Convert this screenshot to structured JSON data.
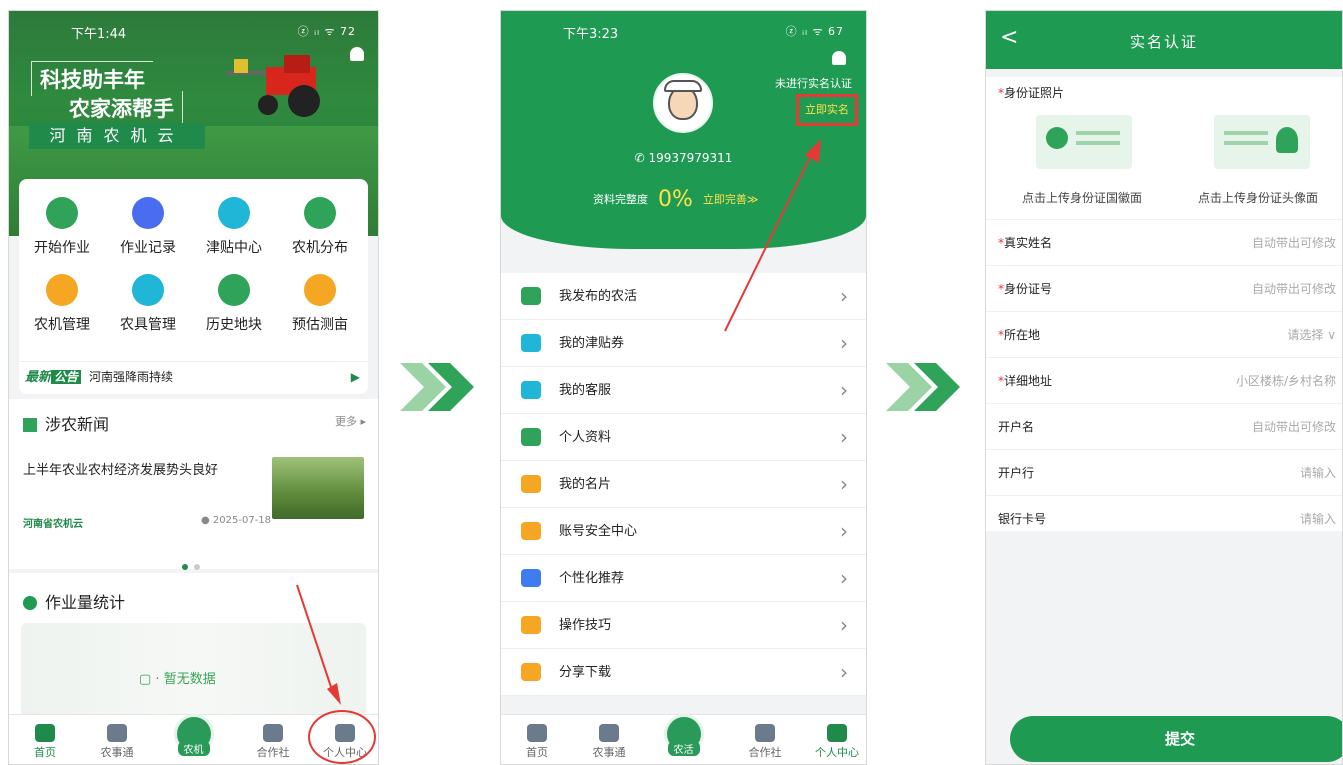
{
  "colors": {
    "primary": "#1f9a53",
    "accent_yellow": "#ffe14d",
    "highlight_red": "#e53935"
  },
  "screen1": {
    "status": {
      "time": "下午1:44",
      "signal": "ⓩ ᵢₗ ᯤ 72"
    },
    "banner": {
      "line1": "科技助丰年",
      "line2": "农家添帮手",
      "brand": "河南农机云"
    },
    "grid": [
      {
        "label": "开始作业",
        "icon": "start-work-icon",
        "color": "#2fa35a"
      },
      {
        "label": "作业记录",
        "icon": "work-record-icon",
        "color": "#4a6cf0"
      },
      {
        "label": "津贴中心",
        "icon": "subsidy-icon",
        "color": "#1fb6d8"
      },
      {
        "label": "农机分布",
        "icon": "machine-map-icon",
        "color": "#2fa35a"
      },
      {
        "label": "农机管理",
        "icon": "machine-manage-icon",
        "color": "#f5a623"
      },
      {
        "label": "农具管理",
        "icon": "tool-manage-icon",
        "color": "#1fb6d8"
      },
      {
        "label": "历史地块",
        "icon": "history-plot-icon",
        "color": "#2fa35a"
      },
      {
        "label": "预估测亩",
        "icon": "estimate-icon",
        "color": "#f5a623"
      }
    ],
    "notice": {
      "tag1": "最新",
      "tag2": "公告",
      "text": "河南强降雨持续"
    },
    "news": {
      "section": "涉农新闻",
      "more": "更多 ▸",
      "title": "上半年农业农村经济发展势头良好",
      "source": "河南省农机云",
      "date": "2025-07-18"
    },
    "stats": {
      "section": "作业量统计",
      "empty": "暂无数据"
    },
    "tabs": [
      {
        "label": "首页",
        "active": true
      },
      {
        "label": "农事通",
        "active": false
      },
      {
        "label": "农机",
        "active": false
      },
      {
        "label": "合作社",
        "active": false
      },
      {
        "label": "个人中心",
        "active": false
      }
    ]
  },
  "screen2": {
    "status": {
      "time": "下午3:23",
      "signal": "ⓩ ᵢₗ ᯤ 67"
    },
    "phone": "19937979311",
    "verify_status": "未进行实名认证",
    "verify_button": "立即实名",
    "completeness_label": "资料完整度",
    "completeness_value": "0%",
    "completeness_action": "立即完善≫",
    "menu": [
      {
        "label": "我发布的农活",
        "color": "#2fa35a"
      },
      {
        "label": "我的津贴券",
        "color": "#1fb6d8"
      },
      {
        "label": "我的客服",
        "color": "#1fb6d8"
      },
      {
        "label": "个人资料",
        "color": "#2fa35a"
      },
      {
        "label": "我的名片",
        "color": "#f5a623"
      },
      {
        "label": "账号安全中心",
        "color": "#f5a623"
      },
      {
        "label": "个性化推荐",
        "color": "#3f7cf0"
      },
      {
        "label": "操作技巧",
        "color": "#f5a623"
      },
      {
        "label": "分享下载",
        "color": "#f5a623"
      }
    ],
    "tabs": [
      {
        "label": "首页",
        "active": false
      },
      {
        "label": "农事通",
        "active": false
      },
      {
        "label": "农活",
        "active": false
      },
      {
        "label": "合作社",
        "active": false
      },
      {
        "label": "个人中心",
        "active": true
      }
    ]
  },
  "screen3": {
    "title": "实名认证",
    "photo_label": "身份证照片",
    "upload_front": "点击上传身份证国徽面",
    "upload_back": "点击上传身份证头像面",
    "fields": [
      {
        "label": "真实姓名",
        "required": true,
        "value": "自动带出可修改"
      },
      {
        "label": "身份证号",
        "required": true,
        "value": "自动带出可修改"
      },
      {
        "label": "所在地",
        "required": true,
        "value": "请选择 ∨"
      },
      {
        "label": "详细地址",
        "required": true,
        "value": "小区楼栋/乡村名称"
      },
      {
        "label": "开户名",
        "required": false,
        "value": "自动带出可修改"
      },
      {
        "label": "开户行",
        "required": false,
        "value": "请输入"
      },
      {
        "label": "银行卡号",
        "required": false,
        "value": "请输入"
      }
    ],
    "submit": "提交"
  }
}
